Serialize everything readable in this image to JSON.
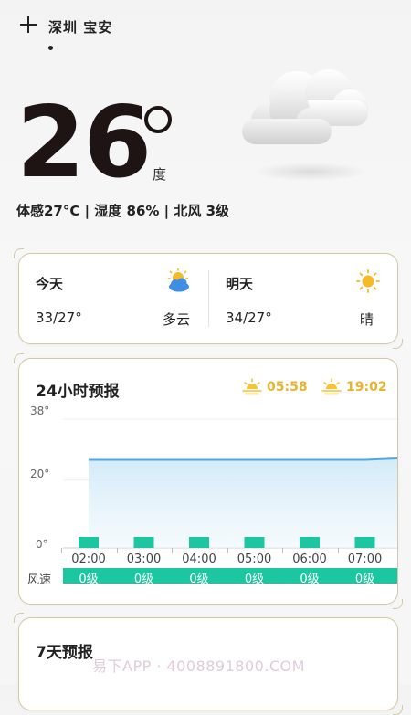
{
  "header": {
    "location": "深圳 宝安"
  },
  "current": {
    "temp": "26",
    "unit": "度",
    "details": "体感27°C | 湿度 86% | 北风 3级"
  },
  "today": {
    "label": "今天",
    "temp": "33/27°",
    "condition": "多云",
    "icon": "partly-cloudy-icon"
  },
  "tomorrow": {
    "label": "明天",
    "temp": "34/27°",
    "condition": "晴",
    "icon": "sunny-icon"
  },
  "forecast24": {
    "title": "24小时预报",
    "sunrise": "05:58",
    "sunset": "19:02",
    "y_labels": [
      "38°",
      "20°",
      "0°"
    ],
    "times": [
      "02:00",
      "03:00",
      "04:00",
      "05:00",
      "06:00",
      "07:00"
    ],
    "wind_label": "风速",
    "wind": [
      "0级",
      "0级",
      "0级",
      "0级",
      "0级",
      "0级"
    ]
  },
  "chart_data": {
    "type": "area",
    "x": [
      "02:00",
      "03:00",
      "04:00",
      "05:00",
      "06:00",
      "07:00"
    ],
    "series": [
      {
        "values": [
          26,
          26,
          26,
          26,
          26,
          26
        ]
      }
    ],
    "ylim": [
      0,
      38
    ],
    "tick_labels_y": [
      "38°",
      "20°",
      "0°"
    ]
  },
  "forecast7": {
    "title": "7天预报"
  },
  "watermark": "易下APP · 4008891800.COM",
  "colors": {
    "accent": "#1bc6a0",
    "sun": "#e9b32b",
    "line": "#4aa9e0",
    "border": "#d6c8a3"
  }
}
